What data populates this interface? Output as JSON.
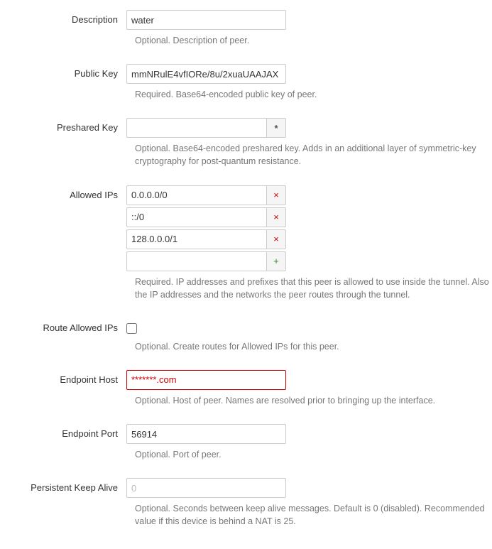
{
  "fields": {
    "description": {
      "label": "Description",
      "value": "water",
      "help": "Optional. Description of peer."
    },
    "public_key": {
      "label": "Public Key",
      "value": "mmNRulE4vfIORe/8u/2xuaUAAJAX",
      "help": "Required. Base64-encoded public key of peer."
    },
    "preshared_key": {
      "label": "Preshared Key",
      "value": "",
      "reveal_symbol": "*",
      "help": "Optional. Base64-encoded preshared key. Adds in an additional layer of symmetric-key cryptography for post-quantum resistance."
    },
    "allowed_ips": {
      "label": "Allowed IPs",
      "items": [
        "0.0.0.0/0",
        "::/0",
        "128.0.0.0/1"
      ],
      "new_value": "",
      "remove_symbol": "×",
      "add_symbol": "+",
      "help": "Required. IP addresses and prefixes that this peer is allowed to use inside the tunnel. Also the IP addresses and the networks the peer routes through the tunnel."
    },
    "route_allowed_ips": {
      "label": "Route Allowed IPs",
      "checked": false,
      "help": "Optional. Create routes for Allowed IPs for this peer."
    },
    "endpoint_host": {
      "label": "Endpoint Host",
      "value": "*******.com",
      "error": true,
      "help": "Optional. Host of peer. Names are resolved prior to bringing up the interface."
    },
    "endpoint_port": {
      "label": "Endpoint Port",
      "value": "56914",
      "help": "Optional. Port of peer."
    },
    "persistent_keep_alive": {
      "label": "Persistent Keep Alive",
      "value": "",
      "placeholder": "0",
      "help": "Optional. Seconds between keep alive messages. Default is 0 (disabled). Recommended value if this device is behind a NAT is 25."
    }
  }
}
